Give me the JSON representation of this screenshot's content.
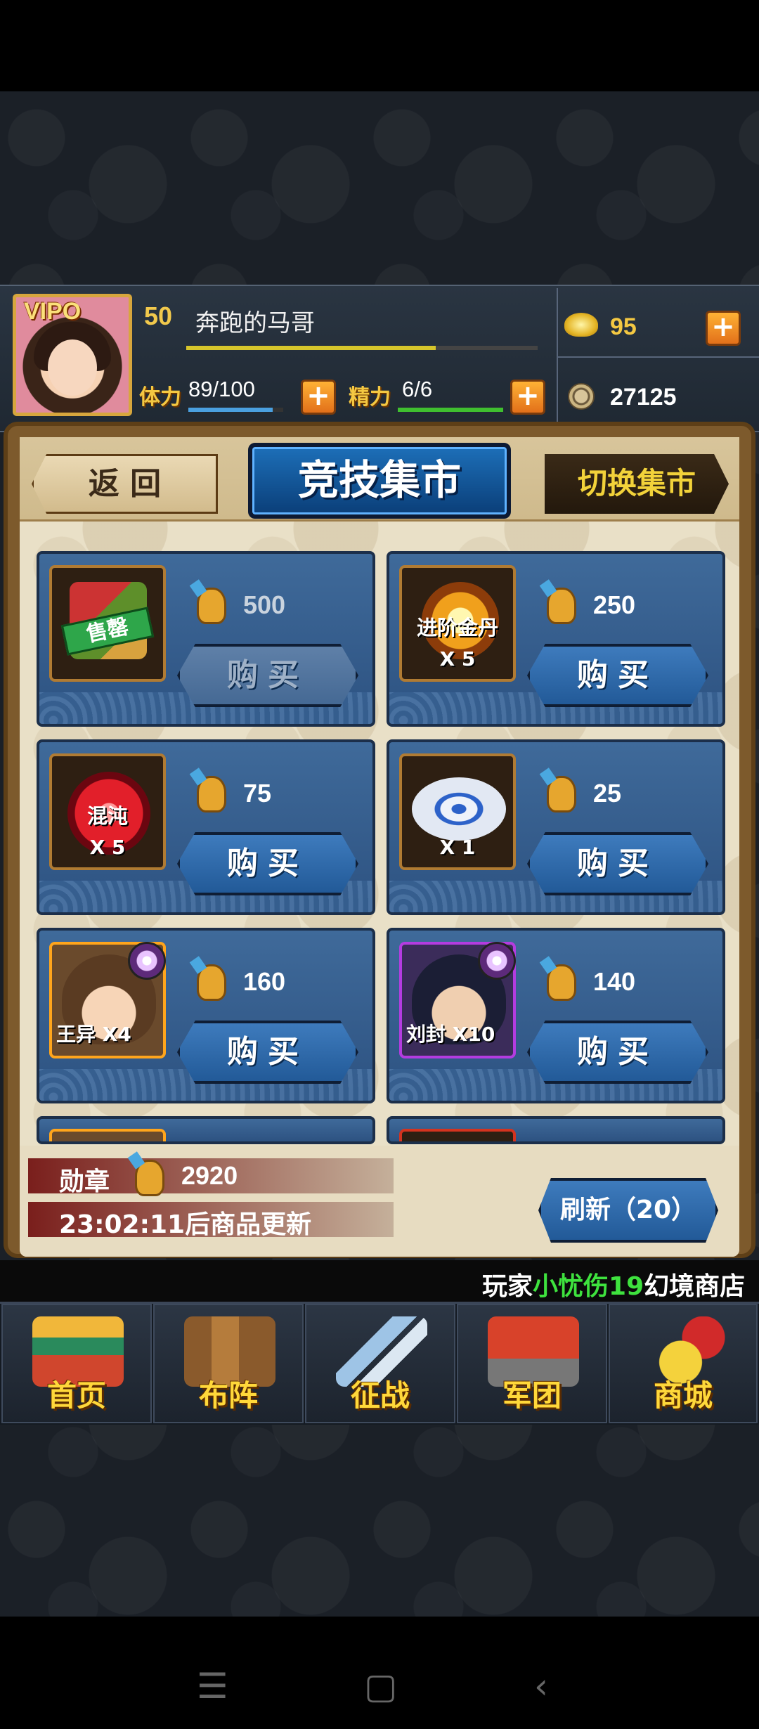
{
  "player": {
    "vip": "VIPO",
    "level": "50",
    "name": "奔跑的马哥",
    "xp_fraction": 0.71
  },
  "stats": {
    "stamina_label": "体力",
    "stamina_value": "89/100",
    "stamina_fraction": 0.89,
    "energy_label": "精力",
    "energy_value": "6/6",
    "energy_fraction": 1.0
  },
  "currency": {
    "gold": "95",
    "coins": "27125"
  },
  "shop": {
    "back_label": "返 回",
    "title": "竞技集市",
    "switch_label": "切换集市",
    "buy_label": "购买",
    "items": [
      {
        "name": "",
        "qty": "",
        "price": "500",
        "sold_out": true,
        "sold_label": "售罄"
      },
      {
        "name": "进阶金丹",
        "qty": "X 5",
        "price": "250",
        "sold_out": false
      },
      {
        "name": "混沌",
        "qty": "X 5",
        "price": "75",
        "sold_out": false
      },
      {
        "name": "",
        "qty": "X 1",
        "price": "25",
        "sold_out": false
      },
      {
        "name": "王异 X4",
        "qty": "",
        "price": "160",
        "sold_out": false
      },
      {
        "name": "刘封 X10",
        "qty": "",
        "price": "140",
        "sold_out": false
      }
    ],
    "medal_label": "勋章",
    "medal_value": "2920",
    "update_text": "23:02:11后商品更新",
    "refresh_label": "刷新（20）"
  },
  "ticker": {
    "prefix": "玩家",
    "player": "小忧伤19",
    "suffix": "幻境商店"
  },
  "nav": {
    "items": [
      "首页",
      "布阵",
      "征战",
      "军团",
      "商城"
    ]
  },
  "colors": {
    "gold_text": "#f4c842",
    "stamina_bar": "#4aa0e0",
    "energy_bar": "#3fbf2f",
    "xp_bar": "#d6c52b",
    "ticker_green": "#3ee23e"
  }
}
